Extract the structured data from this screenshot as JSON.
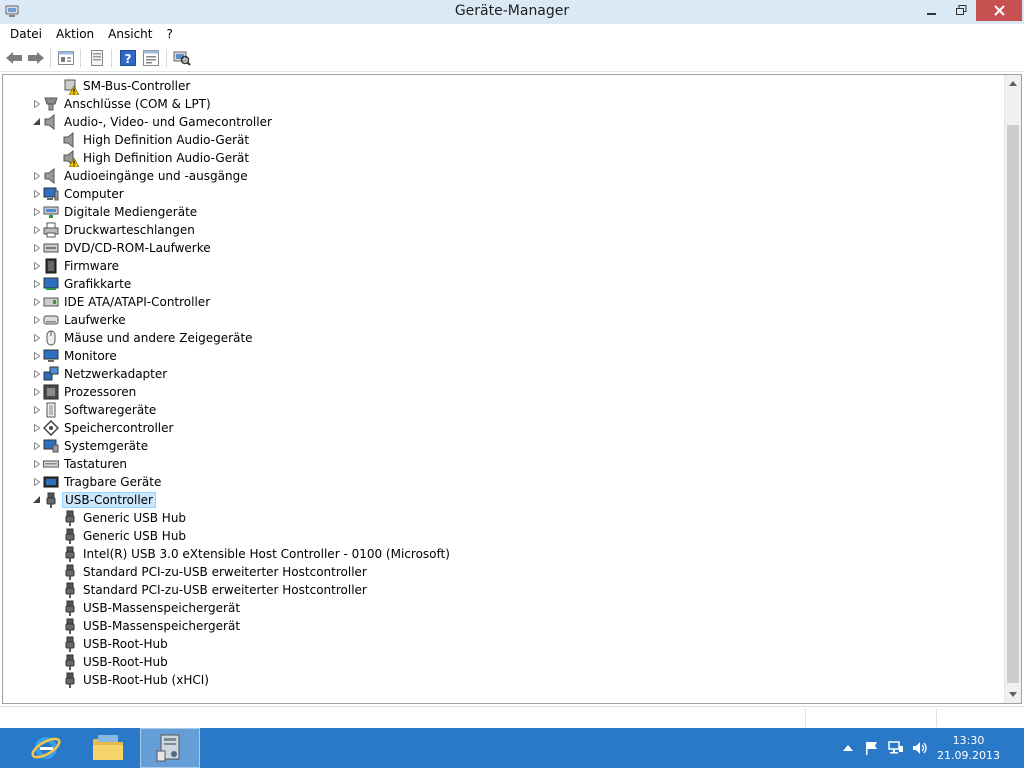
{
  "window": {
    "title": "Geräte-Manager",
    "controls": {
      "minimize": "min",
      "maximize": "max",
      "close": "close"
    }
  },
  "menu": [
    "Datei",
    "Aktion",
    "Ansicht",
    "?"
  ],
  "toolbar": {
    "buttons": [
      "back-icon",
      "forward-icon",
      "properties-icon",
      "driver-icon",
      "help-icon",
      "show-hidden-icon",
      "scan-hardware-icon"
    ]
  },
  "tree": [
    {
      "label": "SM-Bus-Controller",
      "level": 1,
      "icon": "warning-device-icon",
      "warning": true
    },
    {
      "label": "Anschlüsse (COM & LPT)",
      "level": 0,
      "icon": "port-icon",
      "expander": "collapsed"
    },
    {
      "label": "Audio-, Video- und Gamecontroller",
      "level": 0,
      "icon": "speaker-icon",
      "expander": "expanded"
    },
    {
      "label": "High Definition Audio-Gerät",
      "level": 1,
      "icon": "speaker-icon"
    },
    {
      "label": "High Definition Audio-Gerät",
      "level": 1,
      "icon": "speaker-icon",
      "warning": true
    },
    {
      "label": "Audioeingänge und -ausgänge",
      "level": 0,
      "icon": "speaker-icon",
      "expander": "collapsed"
    },
    {
      "label": "Computer",
      "level": 0,
      "icon": "computer-icon",
      "expander": "collapsed"
    },
    {
      "label": "Digitale Mediengeräte",
      "level": 0,
      "icon": "media-device-icon",
      "expander": "collapsed"
    },
    {
      "label": "Druckwarteschlangen",
      "level": 0,
      "icon": "printer-icon",
      "expander": "collapsed"
    },
    {
      "label": "DVD/CD-ROM-Laufwerke",
      "level": 0,
      "icon": "dvd-drive-icon",
      "expander": "collapsed"
    },
    {
      "label": "Firmware",
      "level": 0,
      "icon": "firmware-icon",
      "expander": "collapsed"
    },
    {
      "label": "Grafikkarte",
      "level": 0,
      "icon": "display-adapter-icon",
      "expander": "collapsed"
    },
    {
      "label": "IDE ATA/ATAPI-Controller",
      "level": 0,
      "icon": "ide-controller-icon",
      "expander": "collapsed"
    },
    {
      "label": "Laufwerke",
      "level": 0,
      "icon": "disk-drive-icon",
      "expander": "collapsed"
    },
    {
      "label": "Mäuse und andere Zeigegeräte",
      "level": 0,
      "icon": "mouse-icon",
      "expander": "collapsed"
    },
    {
      "label": "Monitore",
      "level": 0,
      "icon": "monitor-icon",
      "expander": "collapsed"
    },
    {
      "label": "Netzwerkadapter",
      "level": 0,
      "icon": "network-adapter-icon",
      "expander": "collapsed"
    },
    {
      "label": "Prozessoren",
      "level": 0,
      "icon": "processor-icon",
      "expander": "collapsed"
    },
    {
      "label": "Softwaregeräte",
      "level": 0,
      "icon": "software-device-icon",
      "expander": "collapsed"
    },
    {
      "label": "Speichercontroller",
      "level": 0,
      "icon": "storage-controller-icon",
      "expander": "collapsed"
    },
    {
      "label": "Systemgeräte",
      "level": 0,
      "icon": "system-device-icon",
      "expander": "collapsed"
    },
    {
      "label": "Tastaturen",
      "level": 0,
      "icon": "keyboard-icon",
      "expander": "collapsed"
    },
    {
      "label": "Tragbare Geräte",
      "level": 0,
      "icon": "portable-device-icon",
      "expander": "collapsed"
    },
    {
      "label": "USB-Controller",
      "level": 0,
      "icon": "usb-icon",
      "expander": "expanded",
      "selected": true
    },
    {
      "label": "Generic USB Hub",
      "level": 1,
      "icon": "usb-icon"
    },
    {
      "label": "Generic USB Hub",
      "level": 1,
      "icon": "usb-icon"
    },
    {
      "label": "Intel(R) USB 3.0 eXtensible Host Controller - 0100 (Microsoft)",
      "level": 1,
      "icon": "usb-icon"
    },
    {
      "label": "Standard PCI-zu-USB erweiterter Hostcontroller",
      "level": 1,
      "icon": "usb-icon"
    },
    {
      "label": "Standard PCI-zu-USB erweiterter Hostcontroller",
      "level": 1,
      "icon": "usb-icon"
    },
    {
      "label": "USB-Massenspeichergerät",
      "level": 1,
      "icon": "usb-icon"
    },
    {
      "label": "USB-Massenspeichergerät",
      "level": 1,
      "icon": "usb-icon"
    },
    {
      "label": "USB-Root-Hub",
      "level": 1,
      "icon": "usb-icon"
    },
    {
      "label": "USB-Root-Hub",
      "level": 1,
      "icon": "usb-icon"
    },
    {
      "label": "USB-Root-Hub (xHCI)",
      "level": 1,
      "icon": "usb-icon"
    }
  ],
  "taskbar": {
    "apps": [
      "internet-explorer-icon",
      "file-explorer-icon",
      "device-manager-icon"
    ],
    "tray": [
      "show-hidden-icons-icon",
      "action-center-flag-icon",
      "network-icon",
      "volume-icon"
    ],
    "time": "13:30",
    "date": "21.09.2013"
  },
  "colors": {
    "titlebar": "#dbe9f6",
    "close_button": "#c75050",
    "selection": "#cce8ff",
    "taskbar": "#2a78c8",
    "warning": "#f5c400"
  }
}
